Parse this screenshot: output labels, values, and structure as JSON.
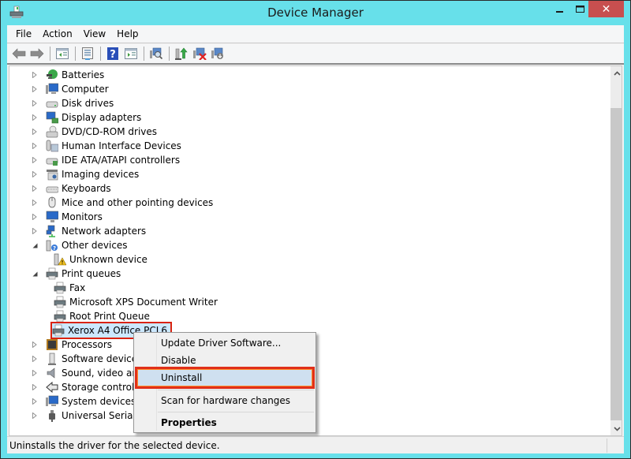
{
  "window": {
    "title": "Device Manager",
    "controls": {
      "minimize": "—",
      "maximize": "☐",
      "close": "✕"
    }
  },
  "menubar": {
    "items": [
      {
        "label": "File"
      },
      {
        "label": "Action"
      },
      {
        "label": "View"
      },
      {
        "label": "Help"
      }
    ]
  },
  "toolbar": {
    "buttons": [
      {
        "name": "back",
        "icon": "back-arrow-icon"
      },
      {
        "name": "forward",
        "icon": "forward-arrow-icon"
      },
      {
        "name": "show-hide-console-tree",
        "icon": "console-tree-icon"
      },
      {
        "name": "properties",
        "icon": "properties-icon"
      },
      {
        "name": "help",
        "icon": "help-icon"
      },
      {
        "name": "show-action-pane",
        "icon": "action-pane-icon"
      },
      {
        "name": "scan-hardware",
        "icon": "scan-hardware-icon"
      },
      {
        "name": "update-driver",
        "icon": "update-driver-icon"
      },
      {
        "name": "uninstall",
        "icon": "uninstall-icon"
      },
      {
        "name": "enable-device",
        "icon": "enable-device-icon"
      }
    ]
  },
  "tree": {
    "nodes": [
      {
        "label": "Batteries",
        "expander": "collapsed",
        "icon": "battery-icon",
        "level": 1
      },
      {
        "label": "Computer",
        "expander": "collapsed",
        "icon": "computer-icon",
        "level": 1
      },
      {
        "label": "Disk drives",
        "expander": "collapsed",
        "icon": "disk-drive-icon",
        "level": 1
      },
      {
        "label": "Display adapters",
        "expander": "collapsed",
        "icon": "display-adapter-icon",
        "level": 1
      },
      {
        "label": "DVD/CD-ROM drives",
        "expander": "collapsed",
        "icon": "dvd-drive-icon",
        "level": 1
      },
      {
        "label": "Human Interface Devices",
        "expander": "collapsed",
        "icon": "hid-icon",
        "level": 1
      },
      {
        "label": "IDE ATA/ATAPI controllers",
        "expander": "collapsed",
        "icon": "ide-controller-icon",
        "level": 1
      },
      {
        "label": "Imaging devices",
        "expander": "collapsed",
        "icon": "camera-icon",
        "level": 1
      },
      {
        "label": "Keyboards",
        "expander": "collapsed",
        "icon": "keyboard-icon",
        "level": 1
      },
      {
        "label": "Mice and other pointing devices",
        "expander": "collapsed",
        "icon": "mouse-icon",
        "level": 1
      },
      {
        "label": "Monitors",
        "expander": "collapsed",
        "icon": "monitor-icon",
        "level": 1
      },
      {
        "label": "Network adapters",
        "expander": "collapsed",
        "icon": "network-adapter-icon",
        "level": 1
      },
      {
        "label": "Other devices",
        "expander": "expanded",
        "icon": "other-devices-icon",
        "level": 1
      },
      {
        "label": "Unknown device",
        "expander": "none",
        "icon": "unknown-device-warning-icon",
        "level": 2
      },
      {
        "label": "Print queues",
        "expander": "expanded",
        "icon": "printer-icon",
        "level": 1
      },
      {
        "label": "Fax",
        "expander": "none",
        "icon": "printer-icon",
        "level": 2
      },
      {
        "label": "Microsoft XPS Document Writer",
        "expander": "none",
        "icon": "printer-icon",
        "level": 2
      },
      {
        "label": "Root Print Queue",
        "expander": "none",
        "icon": "printer-icon",
        "level": 2
      },
      {
        "label": "Xerox A4 Office PCL6",
        "expander": "none",
        "icon": "printer-icon",
        "level": 2,
        "selected": true
      },
      {
        "label": "Processors",
        "expander": "collapsed",
        "icon": "processor-icon",
        "level": 1
      },
      {
        "label": "Software devices",
        "expander": "collapsed",
        "icon": "software-device-icon",
        "level": 1
      },
      {
        "label": "Sound, video and game controllers",
        "expander": "collapsed",
        "icon": "speaker-icon",
        "level": 1
      },
      {
        "label": "Storage controllers",
        "expander": "collapsed",
        "icon": "storage-controller-icon",
        "level": 1
      },
      {
        "label": "System devices",
        "expander": "collapsed",
        "icon": "system-devices-icon",
        "level": 1
      },
      {
        "label": "Universal Serial Bus controllers",
        "expander": "collapsed",
        "icon": "usb-icon",
        "level": 1
      }
    ]
  },
  "context_menu": {
    "items": [
      {
        "label": "Update Driver Software..."
      },
      {
        "label": "Disable"
      },
      {
        "label": "Uninstall",
        "highlighted": true
      },
      {
        "label": "Scan for hardware changes"
      },
      {
        "label": "Properties",
        "bold": true
      }
    ]
  },
  "statusbar": {
    "text": "Uninstalls the driver for the selected device."
  },
  "colors": {
    "frame": "#67e0ea",
    "close_button": "#c74f4f",
    "selection": "#cce8ff",
    "annotation_red": "#d9230f",
    "annotation_orange": "#ff8c2a"
  }
}
